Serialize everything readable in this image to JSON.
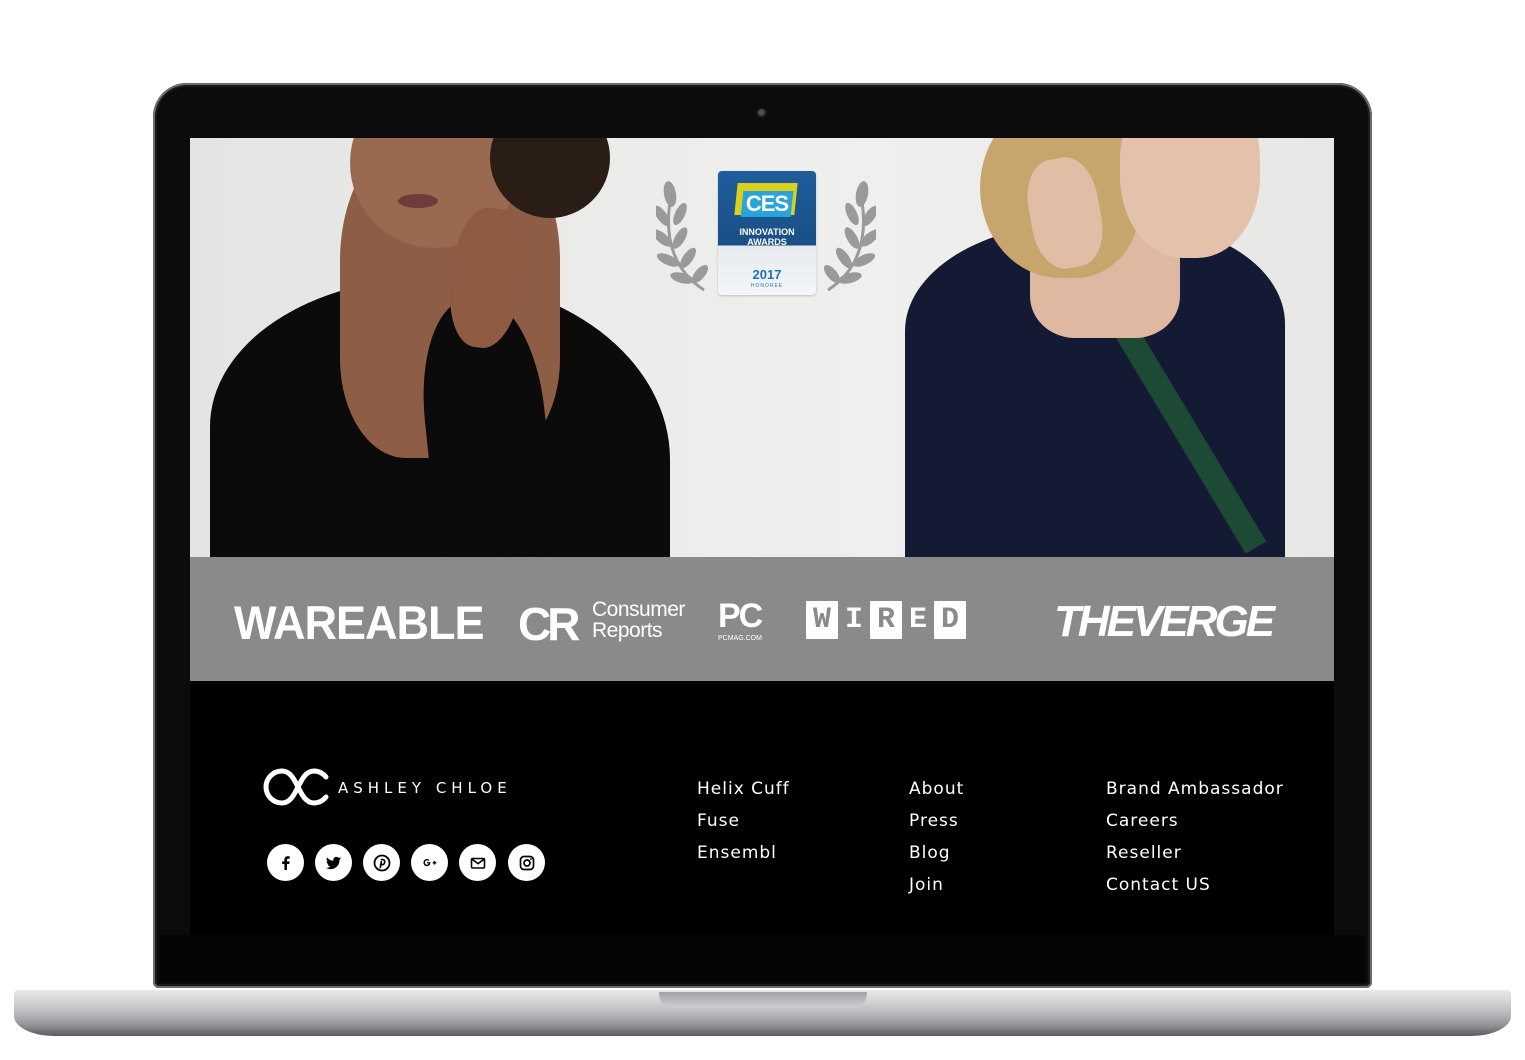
{
  "awards": {
    "ces_logo": "CES",
    "ces_title_line1": "INNOVATION",
    "ces_title_line2": "AWARDS",
    "ces_year": "2017",
    "ces_honoree": "HONOREE"
  },
  "press": {
    "wareable": "WAREABLE",
    "consumer_reports_mark": "CR",
    "consumer_reports_line1": "Consumer",
    "consumer_reports_line2": "Reports",
    "pcmag_mark": "PC",
    "pcmag_sub": "PCMAG.COM",
    "wired_letters": [
      "W",
      "I",
      "R",
      "E",
      "D"
    ],
    "the_verge": "THEVERGE"
  },
  "footer": {
    "brand_name": "ASHLEY CHLOE",
    "social_icons": [
      "facebook-icon",
      "twitter-icon",
      "pinterest-icon",
      "google-plus-icon",
      "email-icon",
      "instagram-icon"
    ],
    "col1": [
      "Helix Cuff",
      "Fuse",
      "Ensembl"
    ],
    "col2": [
      "About",
      "Press",
      "Blog",
      "Join"
    ],
    "col3": [
      "Brand Ambassador",
      "Careers",
      "Reseller",
      "Contact US"
    ]
  },
  "colors": {
    "press_bar": "#8a8a8a",
    "footer_bg": "#000000",
    "ces_blue": "#1f5d9c"
  }
}
